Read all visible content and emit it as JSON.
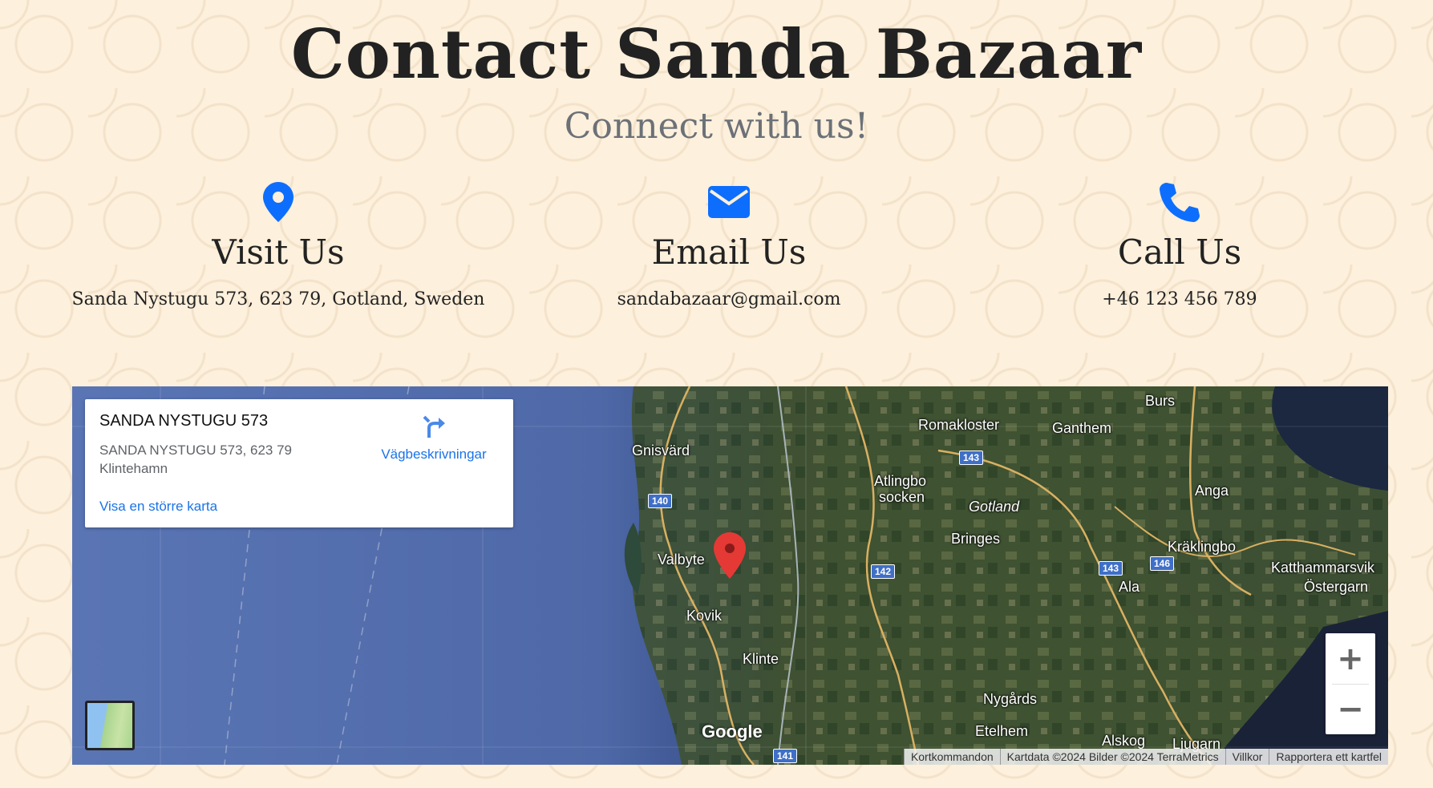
{
  "header": {
    "title": "Contact Sanda Bazaar",
    "subtitle": "Connect with us!"
  },
  "contacts": [
    {
      "icon": "map-marker-icon",
      "heading": "Visit Us",
      "info": "Sanda Nystugu 573, 623 79, Gotland, Sweden"
    },
    {
      "icon": "envelope-icon",
      "heading": "Email Us",
      "info": "sandabazaar@gmail.com"
    },
    {
      "icon": "phone-icon",
      "heading": "Call Us",
      "info": "+46 123 456 789"
    }
  ],
  "colors": {
    "accent": "#0d6efd",
    "background": "#fdf0dc",
    "link": "#1a73e8"
  },
  "map": {
    "card": {
      "place_name": "SANDA NYSTUGU 573",
      "address_line1": "SANDA NYSTUGU 573, 623 79",
      "address_line2": "Klintehamn",
      "larger_map_link": "Visa en större karta",
      "directions_label": "Vägbeskrivningar"
    },
    "labels": {
      "gnisvard": "Gnisvärd",
      "romakloster": "Romakloster",
      "ganthem": "Ganthem",
      "burs": "Burs",
      "atlingbo1": "Atlingbo",
      "atlingbo2": "socken",
      "gotland": "Gotland",
      "anga": "Anga",
      "bringes": "Bringes",
      "kraklingbo": "Kräklingbo",
      "valbyte": "Valbyte",
      "katthammarsvik": "Katthammarsvik",
      "ostergarn": "Östergarn",
      "ala": "Ala",
      "kovik": "Kovik",
      "klinte": "Klinte",
      "nygards": "Nygårds",
      "etelhem": "Etelhem",
      "alskog": "Alskog",
      "ljugarn": "Ljugarn"
    },
    "roads": {
      "r140": "140",
      "r143a": "143",
      "r143b": "143",
      "r142": "142",
      "r146": "146",
      "r141": "141"
    },
    "google_logo": "Google",
    "zoom_in": "+",
    "zoom_out": "−",
    "attribution": [
      "Kortkommandon",
      "Kartdata ©2024 Bilder ©2024 TerraMetrics",
      "Villkor",
      "Rapportera ett kartfel"
    ]
  }
}
